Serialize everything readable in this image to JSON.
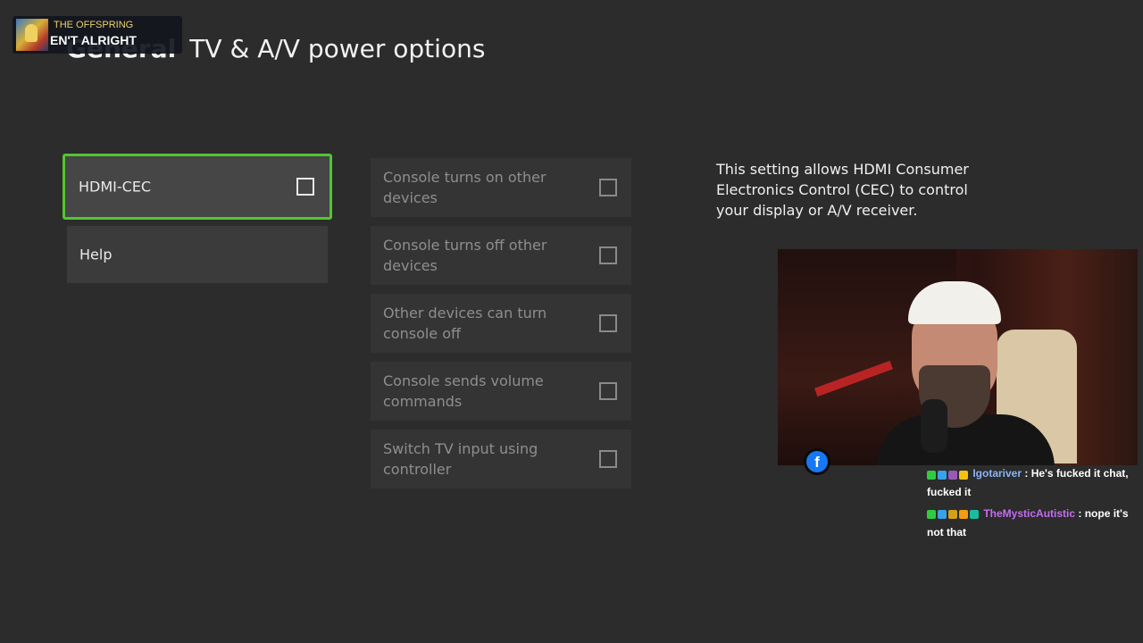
{
  "header": {
    "section": "General",
    "page": "TV & A/V power options"
  },
  "now_playing": {
    "artist": "THE OFFSPRING",
    "title": "EN'T ALRIGHT"
  },
  "left_menu": [
    {
      "label": "HDMI-CEC",
      "checked": false,
      "focused": true
    },
    {
      "label": "Help"
    }
  ],
  "options": [
    {
      "label": "Console turns on other devices",
      "checked": false,
      "enabled": false
    },
    {
      "label": "Console turns off other devices",
      "checked": false,
      "enabled": false
    },
    {
      "label": "Other devices can turn console off",
      "checked": false,
      "enabled": false
    },
    {
      "label": "Console sends volume commands",
      "checked": false,
      "enabled": false
    },
    {
      "label": "Switch TV input using controller",
      "checked": false,
      "enabled": false
    }
  ],
  "description": "This setting allows HDMI Consumer Electronics Control (CEC) to control your display or A/V receiver.",
  "stream": {
    "platform_icon": "facebook-icon",
    "platform_glyph": "f"
  },
  "chat": [
    {
      "user": "Igotariver",
      "message": ": He's fucked it chat, fucked it",
      "user_color": "#8ab4f8",
      "badges": [
        "#2ecc40",
        "#3aa0e8",
        "#9b59b6",
        "#f1c40f"
      ]
    },
    {
      "user": "TheMysticAutistic",
      "message": ": nope it's not that",
      "user_color": "#c56cf0",
      "badges": [
        "#2ecc40",
        "#3aa0e8",
        "#d4a017",
        "#f39c12",
        "#1abc9c"
      ]
    }
  ],
  "colors": {
    "focus_border": "#53c630",
    "background": "#2b2c2b",
    "tile": "#3a3b3a"
  }
}
